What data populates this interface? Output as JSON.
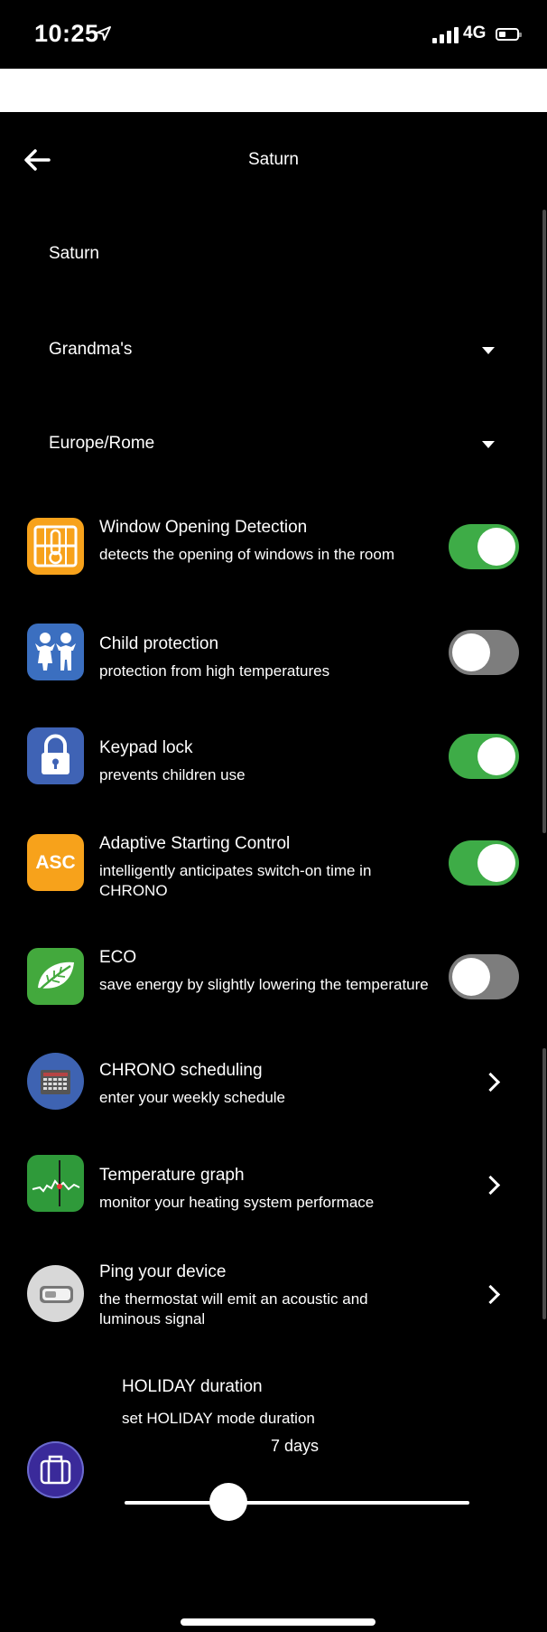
{
  "status_bar": {
    "time": "10:25",
    "network": "4G",
    "battery_level": 0.25
  },
  "header": {
    "title": "Saturn",
    "back_icon": "back-arrow-icon"
  },
  "fields": {
    "name": "Saturn",
    "location": "Grandma's",
    "timezone": "Europe/Rome"
  },
  "settings": [
    {
      "title": "Window Opening Detection",
      "subtitle": "detects the opening of windows in the room",
      "icon": "window-thermometer-icon",
      "enabled": true
    },
    {
      "title": "Child protection",
      "subtitle": "protection from high temperatures",
      "icon": "children-icon",
      "enabled": false
    },
    {
      "title": "Keypad lock",
      "subtitle": "prevents children use",
      "icon": "padlock-icon",
      "enabled": true
    },
    {
      "title": "Adaptive Starting Control",
      "subtitle": "intelligently anticipates switch-on time in CHRONO",
      "icon": "asc-icon",
      "icon_text": "ASC",
      "enabled": true
    },
    {
      "title": "ECO",
      "subtitle": "save energy by slightly lowering the temperature",
      "icon": "leaf-icon",
      "enabled": false
    }
  ],
  "links": [
    {
      "title": "CHRONO scheduling",
      "subtitle": "enter your weekly schedule",
      "icon": "calendar-icon"
    },
    {
      "title": "Temperature graph",
      "subtitle": "monitor your heating system performace",
      "icon": "graph-icon"
    },
    {
      "title": "Ping your device",
      "subtitle": "the thermostat will emit an acoustic and luminous signal",
      "icon": "thermostat-device-icon"
    }
  ],
  "holiday": {
    "title": "HOLIDAY duration",
    "subtitle": "set HOLIDAY mode duration",
    "value_label": "7 days",
    "value_days": 7,
    "slider_fraction": 0.3,
    "icon": "suitcase-icon"
  },
  "colors": {
    "background": "#000000",
    "toggle_on": "#3eac47",
    "toggle_off": "#7d7d7d",
    "window_icon": "#f7a21b",
    "child_icon": "#3b6fc0",
    "lock_icon": "#3f63b5",
    "asc_icon": "#f7a21b",
    "eco_icon": "#43a93d",
    "chrono_icon": "#3e63b2",
    "graph_icon": "#2f9a3a",
    "ping_icon": "#d8d8d8",
    "holiday_icon": "#3a2a9a"
  }
}
